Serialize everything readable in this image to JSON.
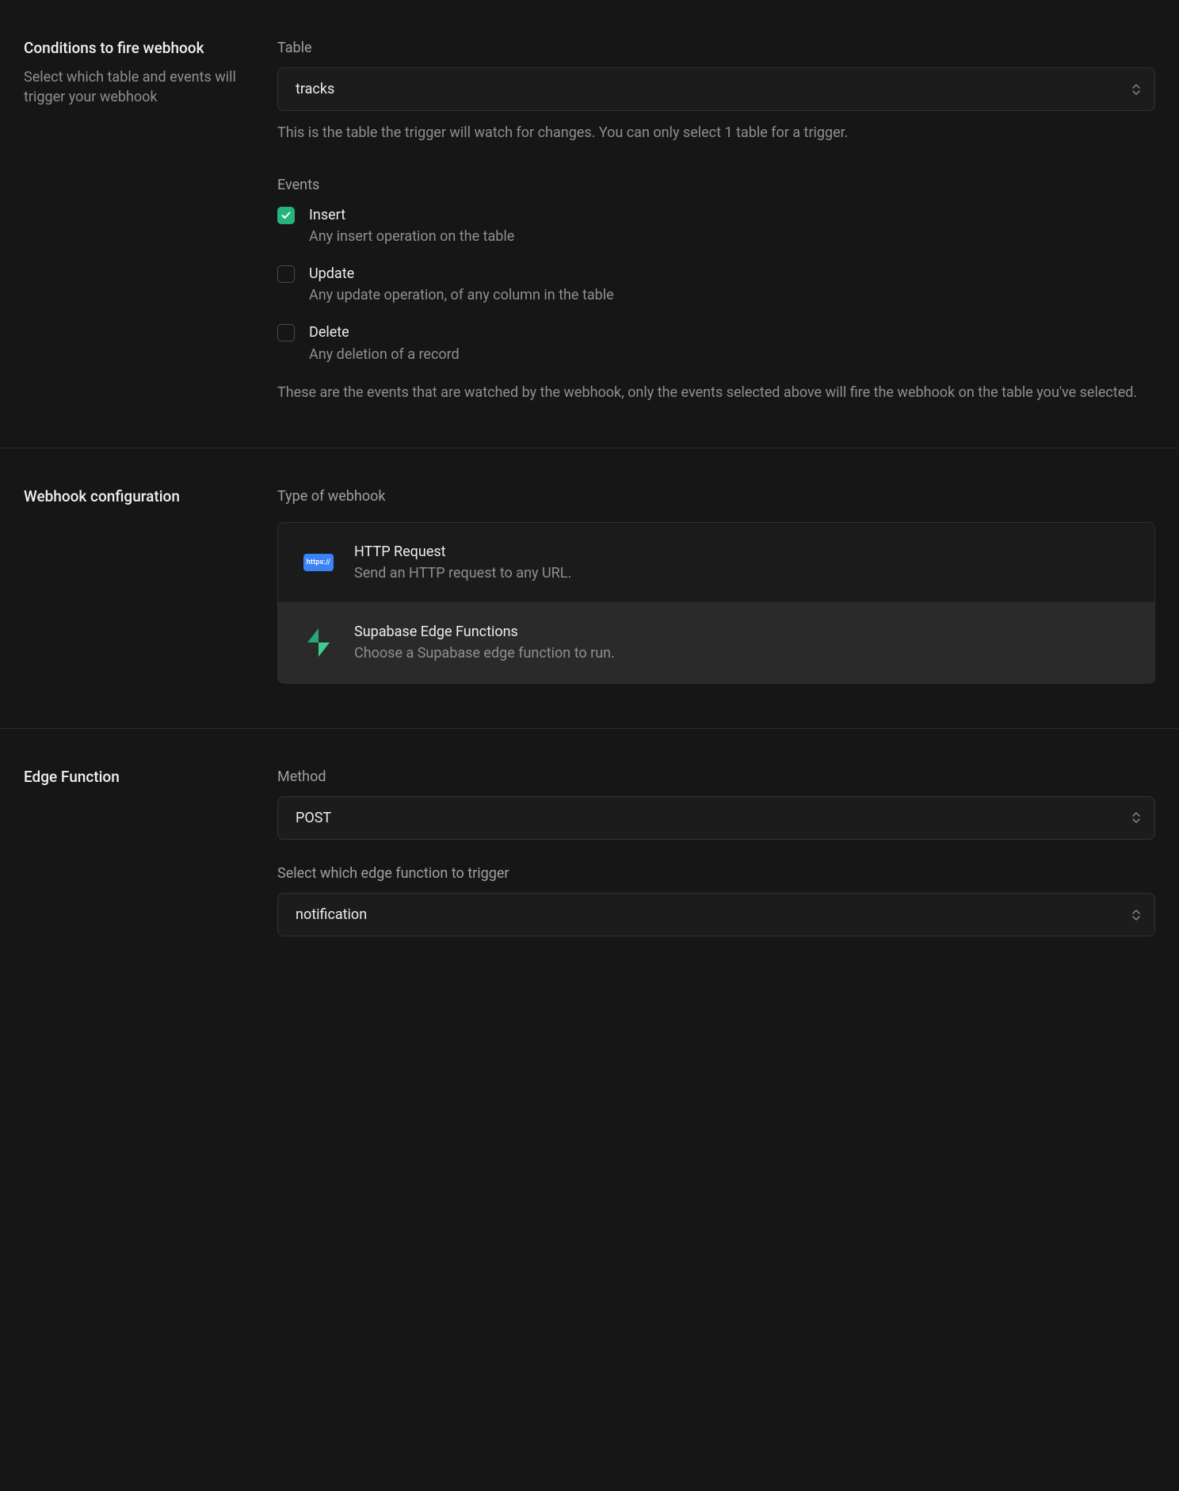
{
  "conditions": {
    "title": "Conditions to fire webhook",
    "subtitle": "Select which table and events will trigger your webhook",
    "table_label": "Table",
    "table_value": "tracks",
    "table_helper": "This is the table the trigger will watch for changes. You can only select 1 table for a trigger.",
    "events_label": "Events",
    "events": [
      {
        "name": "Insert",
        "desc": "Any insert operation on the table",
        "checked": true
      },
      {
        "name": "Update",
        "desc": "Any update operation, of any column in the table",
        "checked": false
      },
      {
        "name": "Delete",
        "desc": "Any deletion of a record",
        "checked": false
      }
    ],
    "events_helper": "These are the events that are watched by the webhook, only the events selected above will fire the webhook on the table you've selected."
  },
  "config": {
    "title": "Webhook configuration",
    "type_label": "Type of webhook",
    "types": [
      {
        "title": "HTTP Request",
        "desc": "Send an HTTP request to any URL.",
        "icon": "http",
        "selected": false
      },
      {
        "title": "Supabase Edge Functions",
        "desc": "Choose a Supabase edge function to run.",
        "icon": "supabase",
        "selected": true
      }
    ]
  },
  "edge": {
    "title": "Edge Function",
    "method_label": "Method",
    "method_value": "POST",
    "fn_label": "Select which edge function to trigger",
    "fn_value": "notification"
  },
  "icons": {
    "http_text": "https://"
  }
}
